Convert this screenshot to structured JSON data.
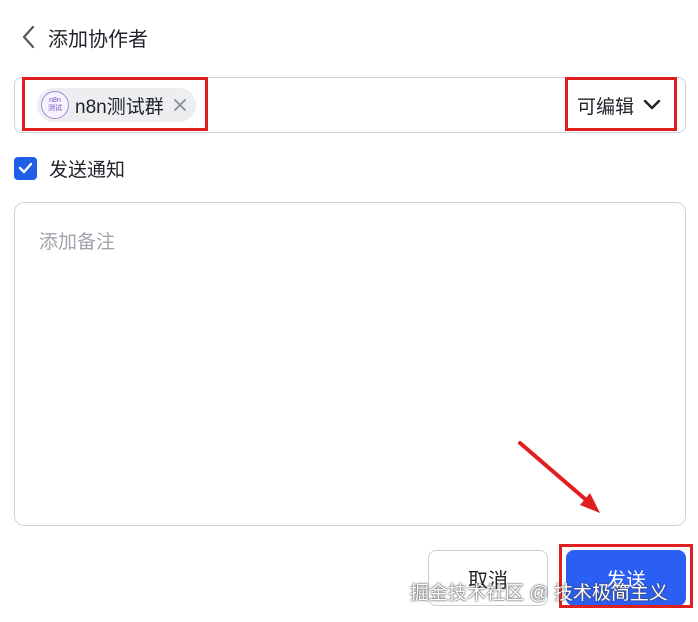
{
  "header": {
    "title": "添加协作者"
  },
  "collaborator": {
    "avatar_line1": "n8n",
    "avatar_line2": "测试",
    "name": "n8n测试群",
    "permission": "可编辑"
  },
  "notify": {
    "label": "发送通知",
    "checked": true
  },
  "note": {
    "placeholder": "添加备注"
  },
  "actions": {
    "cancel": "取消",
    "send": "发送"
  },
  "watermark": "掘金技术社区 @ 技术极简主义",
  "colors": {
    "primary": "#2b5ef3",
    "annotation_red": "#e02020",
    "checkbox": "#1f5ee6"
  }
}
